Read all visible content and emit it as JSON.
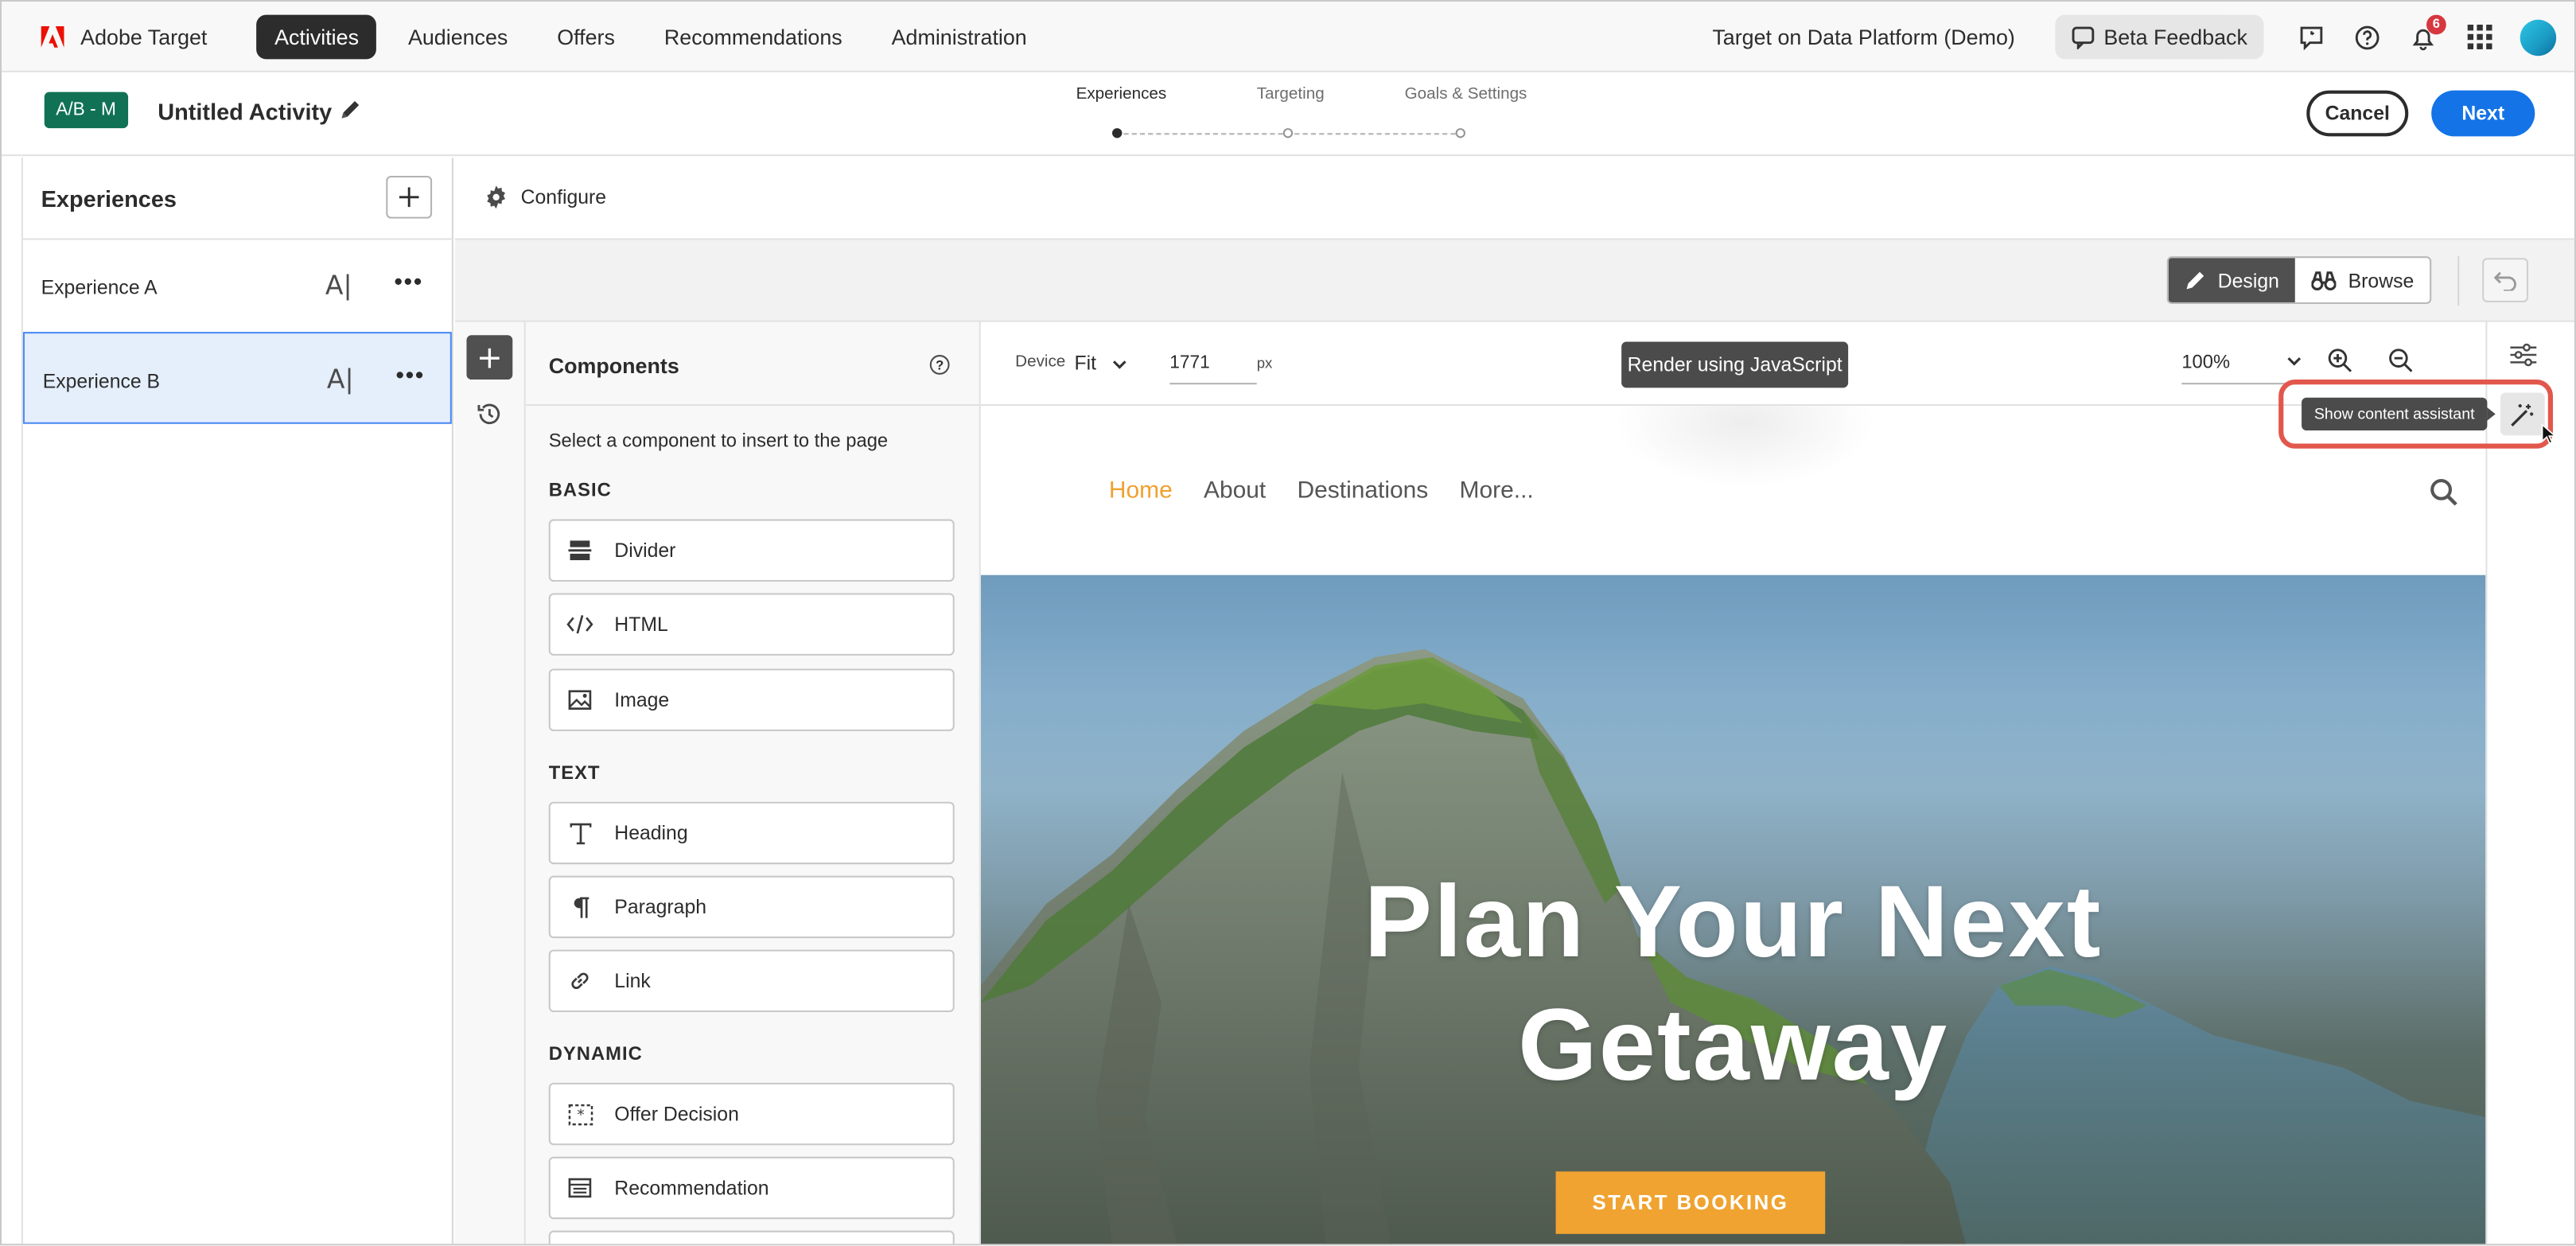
{
  "app": {
    "name": "Adobe Target"
  },
  "nav": {
    "items": [
      {
        "label": "Activities",
        "active": true
      },
      {
        "label": "Audiences",
        "active": false
      },
      {
        "label": "Offers",
        "active": false
      },
      {
        "label": "Recommendations",
        "active": false
      },
      {
        "label": "Administration",
        "active": false
      }
    ]
  },
  "topbar": {
    "org": "Target on Data Platform (Demo)",
    "beta_feedback": "Beta Feedback",
    "notifications_count": "6"
  },
  "activity": {
    "type_badge": "A/B - M",
    "title": "Untitled Activity",
    "steps": [
      {
        "label": "Experiences",
        "active": true
      },
      {
        "label": "Targeting",
        "active": false
      },
      {
        "label": "Goals & Settings",
        "active": false
      }
    ],
    "cancel_label": "Cancel",
    "next_label": "Next"
  },
  "experiences": {
    "title": "Experiences",
    "items": [
      {
        "label": "Experience A",
        "selected": false
      },
      {
        "label": "Experience B",
        "selected": true
      }
    ]
  },
  "configure": {
    "label": "Configure"
  },
  "mode": {
    "design": "Design",
    "browse": "Browse",
    "active": "Design"
  },
  "components": {
    "title": "Components",
    "subtitle": "Select a component to insert to the page",
    "sections": [
      {
        "name": "BASIC",
        "items": [
          "Divider",
          "HTML",
          "Image"
        ]
      },
      {
        "name": "TEXT",
        "items": [
          "Heading",
          "Paragraph",
          "Link"
        ]
      },
      {
        "name": "DYNAMIC",
        "items": [
          "Offer Decision",
          "Recommendation"
        ]
      }
    ]
  },
  "canvas": {
    "device_label": "Device",
    "device_value": "Fit",
    "width_value": "1771",
    "width_unit": "px",
    "render_button": "Render using JavaScript",
    "zoom": "100%",
    "tooltip": "Show content assistant"
  },
  "site": {
    "links": [
      "Home",
      "About",
      "Destinations",
      "More..."
    ],
    "hero_title_line1": "Plan Your Next",
    "hero_title_line2": "Getaway",
    "cta": "START BOOKING"
  },
  "colors": {
    "primary": "#1473e6",
    "badge_green": "#107154",
    "accent_orange": "#f0a330",
    "highlight_red": "#e2574c",
    "selected_bg": "#e5effc"
  }
}
